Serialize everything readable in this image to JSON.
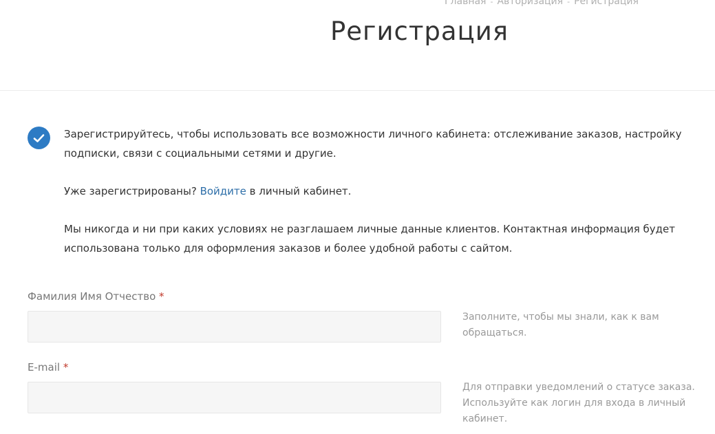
{
  "breadcrumb": {
    "items": [
      "Главная",
      "Авторизация",
      "Регистрация"
    ],
    "separator": "-"
  },
  "page": {
    "title": "Регистрация"
  },
  "notice": {
    "icon": "check-circle-icon",
    "intro": " Зарегистрируйтесь, чтобы использовать все возможности личного кабинета: отслеживание заказов, настройку подписки, связи с социальными сетями и другие.",
    "already_prefix": "Уже зарегистрированы? ",
    "login_link": "Войдите",
    "already_suffix": " в личный кабинет.",
    "privacy": "Мы никогда и ни при каких условиях не разглашаем личные данные клиентов. Контактная информация будет использована только для оформления заказов и более удобной работы с сайтом."
  },
  "form": {
    "fullname": {
      "label": "Фамилия Имя Отчество",
      "required_mark": "*",
      "value": "",
      "hint": "Заполните, чтобы мы знали, как к вам обращаться."
    },
    "email": {
      "label": "E-mail",
      "required_mark": "*",
      "value": "",
      "hint": "Для отправки уведомлений о статусе заказа. Используйте как логин для входа в личный кабинет."
    }
  },
  "colors": {
    "accent": "#2d7bc4",
    "link": "#2d6ea8",
    "required": "#c0392b",
    "input_bg": "#f6f6f6"
  }
}
